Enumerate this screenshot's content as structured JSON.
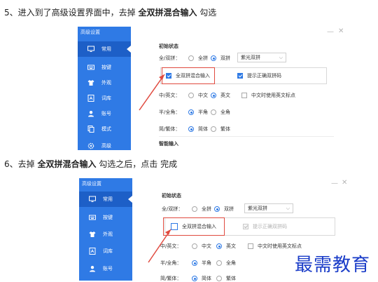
{
  "steps": [
    {
      "number": "5、",
      "before": "进入到了高级设置界面中，去掉 ",
      "bold": "全双拼混合输入",
      "after": " 勾选"
    },
    {
      "number": "6、",
      "before": "去掉 ",
      "bold": "全双拼混合输入",
      "after": " 勾选之后，点击 完成"
    }
  ],
  "screenshot_1": {
    "sidebar_title": "高级设置",
    "sidebar_items": [
      {
        "label": "常用",
        "icon": "monitor-icon",
        "active": true
      },
      {
        "label": "按键",
        "icon": "keyboard-icon",
        "active": false
      },
      {
        "label": "外观",
        "icon": "shirt-icon",
        "active": false
      },
      {
        "label": "词库",
        "icon": "book-icon",
        "active": false
      },
      {
        "label": "账号",
        "icon": "user-icon",
        "active": false
      },
      {
        "label": "模式",
        "icon": "copy-icon",
        "active": false
      },
      {
        "label": "高级",
        "icon": "gear-icon",
        "active": false
      }
    ],
    "section_initial": "初始状态",
    "quan_shuang_label": "全/双拼：",
    "opt_quanpin": "全拼",
    "opt_shuangpin": "双拼",
    "scheme_select": "紫光双拼",
    "mixed_input": "全双拼混合输入",
    "mixed_checked": true,
    "hint_correct": "提示正确双拼码",
    "hint_checked": true,
    "cn_en_label": "中/英文：",
    "opt_chinese": "中文",
    "opt_english": "英文",
    "punct_option": "中文时使用英文标点",
    "half_full_label": "半/全角：",
    "opt_half": "半角",
    "opt_full": "全角",
    "simp_trad_label": "简/繁体：",
    "opt_simplified": "简体",
    "opt_traditional": "繁体",
    "section_smart": "智能输入"
  },
  "screenshot_2": {
    "sidebar_title": "高级设置",
    "sidebar_items": [
      {
        "label": "常用",
        "icon": "monitor-icon",
        "active": true
      },
      {
        "label": "按键",
        "icon": "keyboard-icon",
        "active": false
      },
      {
        "label": "外观",
        "icon": "shirt-icon",
        "active": false
      },
      {
        "label": "词库",
        "icon": "book-icon",
        "active": false
      },
      {
        "label": "账号",
        "icon": "user-icon",
        "active": false
      }
    ],
    "section_initial": "初始状态",
    "quan_shuang_label": "全/双拼：",
    "opt_quanpin": "全拼",
    "opt_shuangpin": "双拼",
    "scheme_select": "紫光双拼",
    "mixed_input": "全双拼混合输入",
    "mixed_checked": false,
    "hint_correct": "提示正确双拼码",
    "hint_disabled": true,
    "cn_en_label": "中/英文：",
    "opt_chinese": "中文",
    "opt_english": "英文",
    "punct_option": "中文时使用英文标点",
    "half_full_label": "半/全角：",
    "opt_half": "半角",
    "opt_full": "全角",
    "simp_trad_label": "简/繁体：",
    "opt_simplified": "简体",
    "opt_traditional": "繁体"
  },
  "watermark": "最需教育",
  "colors": {
    "sidebar": "#2f7ae5",
    "sidebar_active": "#1d5fc7",
    "highlight": "#e04a3f",
    "watermark": "#1a3cc8",
    "accent": "#2f7ae5"
  }
}
